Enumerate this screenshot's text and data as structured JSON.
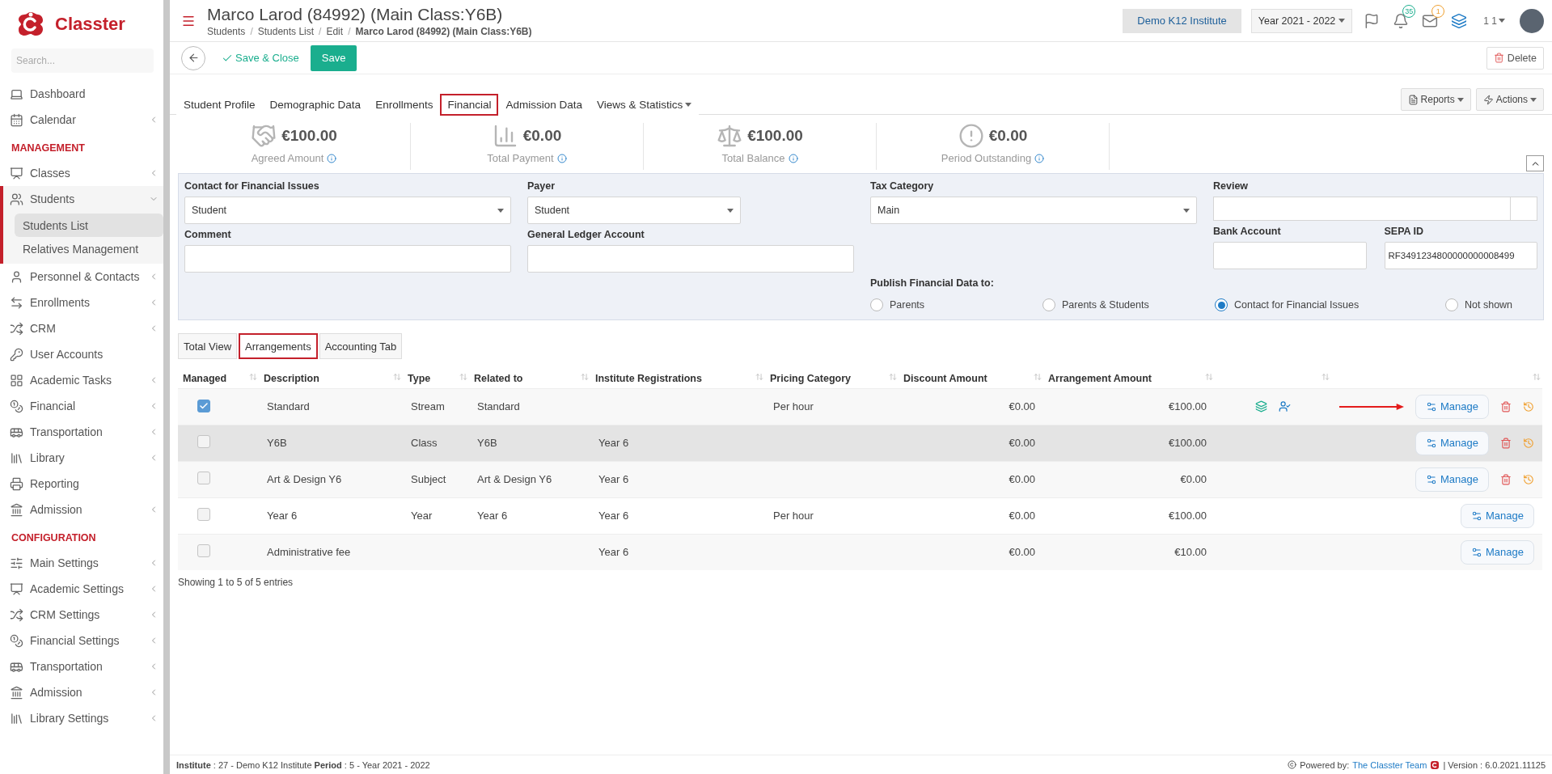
{
  "sidebar": {
    "logo": "Classter",
    "search": {
      "placeholder": "Search..."
    },
    "sections": [
      {
        "items": [
          {
            "label": "Dashboard",
            "expandable": false
          },
          {
            "label": "Calendar",
            "expandable": true
          }
        ]
      },
      {
        "heading": "MANAGEMENT",
        "items": [
          {
            "label": "Classes",
            "expandable": true
          },
          {
            "label": "Students",
            "expandable": true,
            "expanded": true,
            "children": [
              {
                "label": "Students List",
                "selected": true
              },
              {
                "label": "Relatives Management",
                "selected": false
              }
            ]
          },
          {
            "label": "Personnel & Contacts",
            "expandable": true
          },
          {
            "label": "Enrollments",
            "expandable": true
          },
          {
            "label": "CRM",
            "expandable": true
          },
          {
            "label": "User Accounts",
            "expandable": false
          },
          {
            "label": "Academic Tasks",
            "expandable": true
          },
          {
            "label": "Financial",
            "expandable": true
          },
          {
            "label": "Transportation",
            "expandable": true
          },
          {
            "label": "Library",
            "expandable": true
          },
          {
            "label": "Reporting",
            "expandable": false
          },
          {
            "label": "Admission",
            "expandable": true
          }
        ]
      },
      {
        "heading": "CONFIGURATION",
        "items": [
          {
            "label": "Main Settings",
            "expandable": true
          },
          {
            "label": "Academic Settings",
            "expandable": true
          },
          {
            "label": "CRM Settings",
            "expandable": true
          },
          {
            "label": "Financial Settings",
            "expandable": true
          },
          {
            "label": "Transportation",
            "expandable": true
          },
          {
            "label": "Admission",
            "expandable": true
          },
          {
            "label": "Library Settings",
            "expandable": true
          }
        ]
      }
    ]
  },
  "header": {
    "title": "Marco Larod (84992) (Main Class:Y6B)",
    "breadcrumb_separator": "/",
    "breadcrumb": [
      "Students",
      "Students List",
      "Edit",
      "Marco Larod (84992) (Main Class:Y6B)"
    ],
    "institute": "Demo K12 Institute",
    "year": "Year 2021 - 2022",
    "notifications": "35",
    "messages": "1",
    "user": "1 1"
  },
  "toolbar": {
    "save_close": "Save & Close",
    "save": "Save",
    "delete": "Delete"
  },
  "tabs": [
    {
      "label": "Student Profile",
      "selected": false
    },
    {
      "label": "Demographic Data",
      "selected": false
    },
    {
      "label": "Enrollments",
      "selected": false
    },
    {
      "label": "Financial",
      "selected": true
    },
    {
      "label": "Admission Data",
      "selected": false
    },
    {
      "label": "Views & Statistics",
      "selected": false,
      "kind": "dropdown"
    }
  ],
  "tab_actions": {
    "reports": "Reports",
    "actions": "Actions"
  },
  "summary": [
    {
      "amount": "€100.00",
      "label": "Agreed Amount"
    },
    {
      "amount": "€0.00",
      "label": "Total Payment"
    },
    {
      "amount": "€100.00",
      "label": "Total Balance"
    },
    {
      "amount": "€0.00",
      "label": "Period Outstanding"
    }
  ],
  "form": {
    "contact": {
      "label": "Contact for Financial Issues",
      "value": "Student"
    },
    "payer": {
      "label": "Payer",
      "value": "Student"
    },
    "tax_category": {
      "label": "Tax Category",
      "value": "Main"
    },
    "review": {
      "label": "Review"
    },
    "bank_account": {
      "label": "Bank Account"
    },
    "sepa_id": {
      "label": "SEPA ID",
      "value": "RF3491234800000000008499"
    },
    "comment": {
      "label": "Comment"
    },
    "ledger": {
      "label": "General Ledger Account"
    },
    "publish": {
      "label": "Publish Financial Data to:",
      "options": [
        {
          "label": "Parents",
          "selected": false
        },
        {
          "label": "Parents & Students",
          "selected": false
        },
        {
          "label": "Contact for Financial Issues",
          "selected": true
        },
        {
          "label": "Not shown",
          "selected": false
        }
      ]
    }
  },
  "subtabs": [
    {
      "label": "Total View",
      "selected": false
    },
    {
      "label": "Arrangements",
      "selected": true
    },
    {
      "label": "Accounting Tab",
      "selected": false
    }
  ],
  "table": {
    "columns": [
      "Managed",
      "Description",
      "Type",
      "Related to",
      "Institute Registrations",
      "Pricing Category",
      "Discount Amount",
      "Arrangement Amount"
    ],
    "rows": [
      {
        "checked": true,
        "selected": false,
        "description": "Standard",
        "type": "Stream",
        "related_to": "Standard",
        "registrations": "",
        "pricing": "Per hour",
        "discount": "€0.00",
        "amount": "€100.00",
        "status_icons": true,
        "arrow": true,
        "deletable": true,
        "manage": "Manage"
      },
      {
        "checked": false,
        "selected": true,
        "description": "Y6B",
        "type": "Class",
        "related_to": "Y6B",
        "registrations": "Year 6",
        "pricing": "",
        "discount": "€0.00",
        "amount": "€100.00",
        "status_icons": false,
        "arrow": false,
        "deletable": true,
        "manage": "Manage"
      },
      {
        "checked": false,
        "selected": false,
        "description": "Art & Design Y6",
        "type": "Subject",
        "related_to": "Art & Design Y6",
        "registrations": "Year 6",
        "pricing": "",
        "discount": "€0.00",
        "amount": "€0.00",
        "status_icons": false,
        "arrow": false,
        "deletable": true,
        "manage": "Manage"
      },
      {
        "checked": false,
        "selected": false,
        "description": "Year 6",
        "type": "Year",
        "related_to": "Year 6",
        "registrations": "Year 6",
        "pricing": "Per hour",
        "discount": "€0.00",
        "amount": "€100.00",
        "status_icons": false,
        "arrow": false,
        "deletable": false,
        "manage": "Manage"
      },
      {
        "checked": false,
        "selected": false,
        "description": "Administrative fee",
        "type": "",
        "related_to": "",
        "registrations": "Year 6",
        "pricing": "",
        "discount": "€0.00",
        "amount": "€10.00",
        "status_icons": false,
        "arrow": false,
        "deletable": false,
        "manage": "Manage"
      }
    ],
    "info": "Showing 1 to 5 of 5 entries"
  },
  "footer": {
    "context": "**Institute** : 27 - Demo K12 Institute **Period** : 5 - Year 2021 - 2022",
    "powered_by": "Powered by:",
    "team_link": "The Classter Team",
    "version": "| Version : 6.0.2021.11125"
  }
}
